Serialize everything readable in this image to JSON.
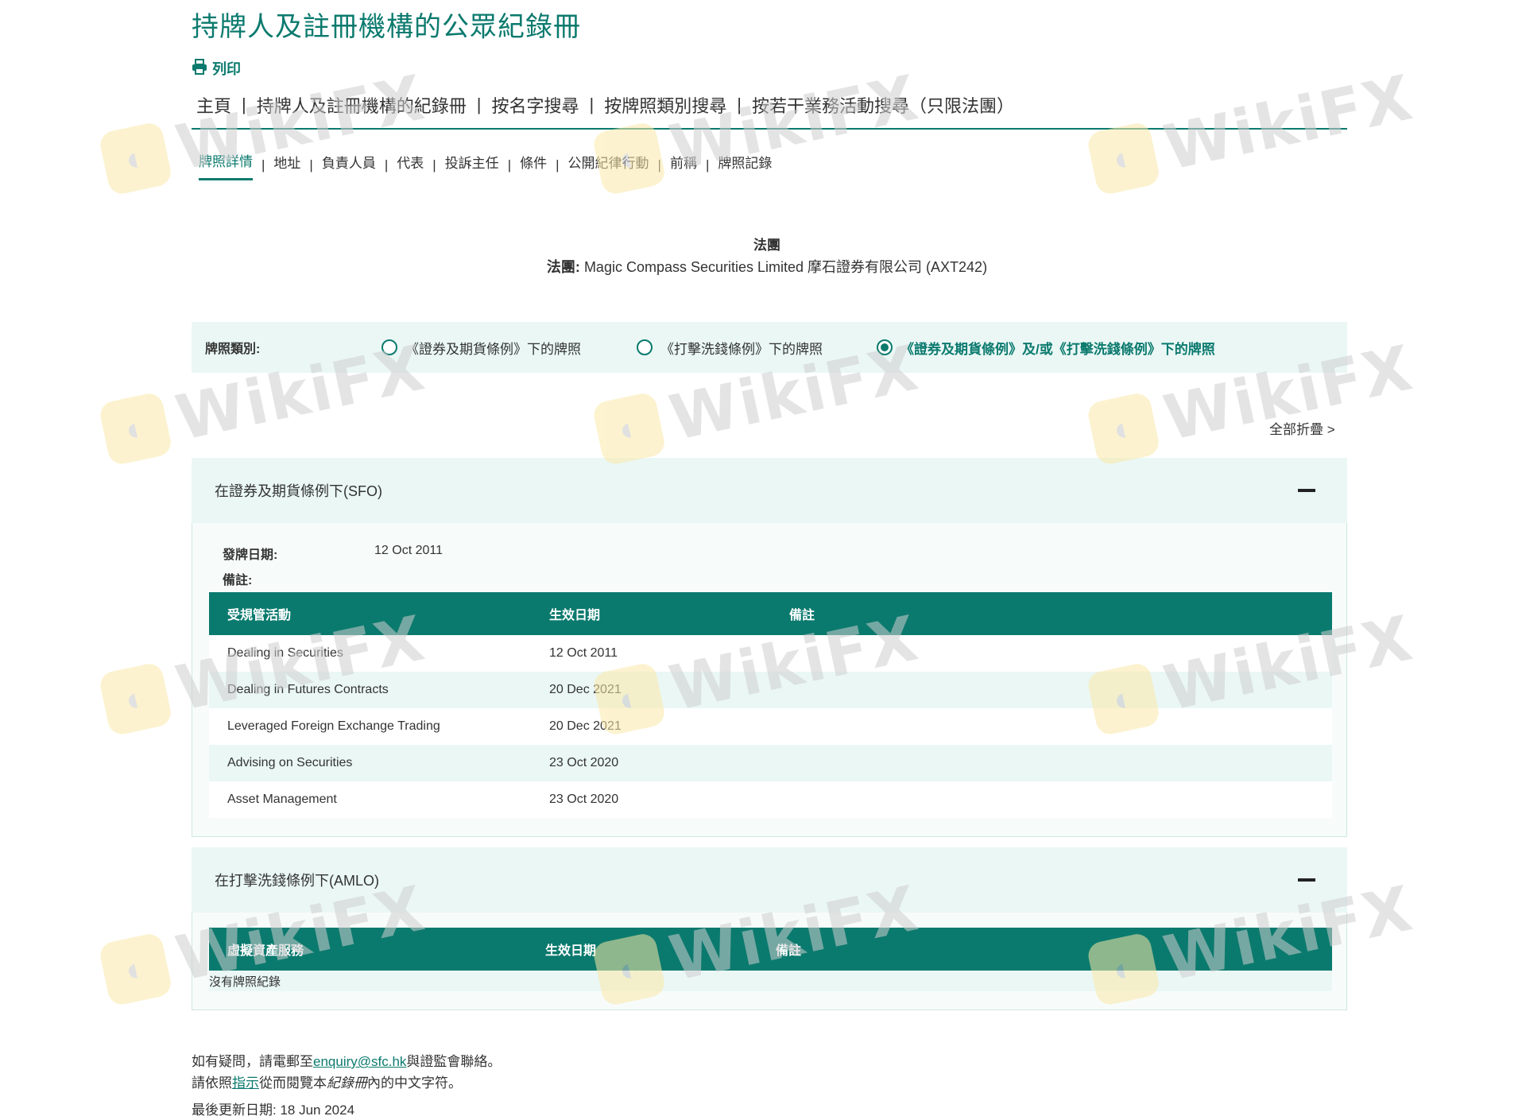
{
  "page_title": "持牌人及註冊機構的公眾紀錄冊",
  "print_label": "列印",
  "top_nav": [
    "主頁",
    "持牌人及註冊機構的紀錄冊",
    "按名字搜尋",
    "按牌照類別搜尋",
    "按若干業務活動搜尋（只限法團）"
  ],
  "sub_nav": [
    "牌照詳情",
    "地址",
    "負責人員",
    "代表",
    "投訴主任",
    "條件",
    "公開紀律行動",
    "前稱",
    "牌照記錄"
  ],
  "corporation": {
    "heading": "法團",
    "label": "法團:",
    "name": "Magic Compass Securities Limited 摩石證券有限公司 (AXT242)"
  },
  "license_type": {
    "label": "牌照類別:",
    "options": [
      {
        "label": "《證券及期貨條例》下的牌照",
        "selected": false
      },
      {
        "label": "《打擊洗錢條例》下的牌照",
        "selected": false
      },
      {
        "label": "《證券及期貨條例》及/或《打擊洗錢條例》下的牌照",
        "selected": true
      }
    ]
  },
  "collapse_all_label": "全部折疊 >",
  "sfo_section": {
    "title": "在證券及期貨條例下(SFO)",
    "issue_date_label": "發牌日期:",
    "issue_date": "12 Oct 2011",
    "remarks_label": "備註:",
    "columns": [
      "受規管活動",
      "生效日期",
      "備註"
    ],
    "rows": [
      {
        "activity": "Dealing in Securities",
        "date": "12 Oct 2011",
        "remark": ""
      },
      {
        "activity": "Dealing in Futures Contracts",
        "date": "20 Dec 2021",
        "remark": ""
      },
      {
        "activity": "Leveraged Foreign Exchange Trading",
        "date": "20 Dec 2021",
        "remark": ""
      },
      {
        "activity": "Advising on Securities",
        "date": "23 Oct 2020",
        "remark": ""
      },
      {
        "activity": "Asset Management",
        "date": "23 Oct 2020",
        "remark": ""
      }
    ]
  },
  "amlo_section": {
    "title": "在打擊洗錢條例下(AMLO)",
    "columns": [
      "虛擬資產服務",
      "生效日期",
      "備註"
    ],
    "no_record": "沒有牌照紀錄"
  },
  "footer": {
    "line1_prefix": "如有疑問，請電郵至",
    "email": "enquiry@sfc.hk",
    "line1_suffix": "與證監會聯絡。",
    "line2_prefix": "請依照",
    "guide_link": "指示",
    "line2_middle": "從而閱覽本",
    "register_italic": "紀錄冊",
    "line2_suffix": "內的中文字符。",
    "updated": "最後更新日期: 18 Jun 2024"
  },
  "watermark": {
    "text": "WikiFX",
    "icon": "wikifx-logo-icon"
  },
  "colors": {
    "accent": "#0b7a6e",
    "panel": "#eaf7f5"
  }
}
